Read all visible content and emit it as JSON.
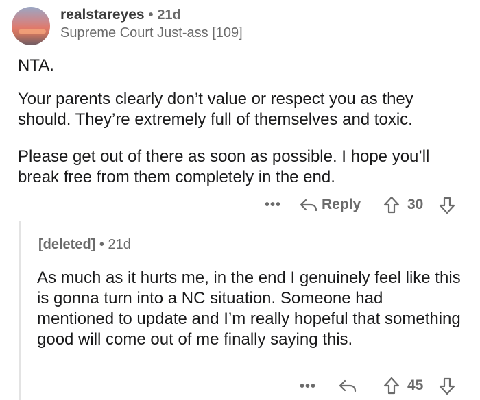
{
  "comment": {
    "username": "realstareyes",
    "separator": "•",
    "time": "21d",
    "flair": "Supreme Court Just-ass [109]",
    "paragraphs": [
      "NTA.",
      "Your parents clearly don’t value or respect you as they should. They’re extremely full of themselves and toxic.",
      "Please get out of there as soon as possible. I hope you’ll break free from them completely in the end."
    ],
    "actions": {
      "more": "•••",
      "reply_label": "Reply",
      "score": "30"
    }
  },
  "reply": {
    "username": "[deleted]",
    "separator": "•",
    "time": "21d",
    "text": "As much as it hurts me, in the end I genuinely feel like this is gonna turn into a NC situation. Someone had mentioned to update and I’m really hopeful that something good will come out of me finally saying this.",
    "actions": {
      "more": "•••",
      "score": "45"
    }
  },
  "icons": {
    "reply": "reply-arrow-icon",
    "upvote": "upvote-arrow-icon",
    "downvote": "downvote-arrow-icon"
  },
  "colors": {
    "text": "#1a1a1b",
    "meta": "#6b6b6b",
    "thread_line": "#e3e3e3"
  }
}
